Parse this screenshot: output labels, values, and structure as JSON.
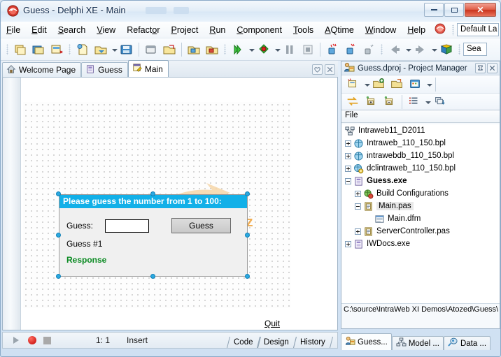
{
  "window": {
    "title": "Guess - Delphi XE - Main",
    "app_icon": "delphi-icon",
    "minimize_label": "Minimize",
    "maximize_label": "Maximize",
    "close_label": "Close"
  },
  "menu": {
    "items": [
      {
        "label": "File",
        "accel": "F"
      },
      {
        "label": "Edit",
        "accel": "E"
      },
      {
        "label": "Search",
        "accel": "S"
      },
      {
        "label": "View",
        "accel": "V"
      },
      {
        "label": "Refactor",
        "accel": "o"
      },
      {
        "label": "Project",
        "accel": "P"
      },
      {
        "label": "Run",
        "accel": "R"
      },
      {
        "label": "Component",
        "accel": "C"
      },
      {
        "label": "Tools",
        "accel": "T"
      },
      {
        "label": "AQtime",
        "accel": "A"
      },
      {
        "label": "Window",
        "accel": "W"
      },
      {
        "label": "Help",
        "accel": "H"
      }
    ],
    "layout_combo_value": "Default La",
    "help_icon": "delphi-help-icon"
  },
  "toolbar": {
    "groups": [
      {
        "icons": [
          "open-project-icon",
          "save-all-icon",
          "open-unit-icon"
        ]
      },
      {
        "icons": [
          "new-file-icon",
          "open-file-icon",
          "save-icon"
        ]
      },
      {
        "icons": [
          "save-as-icon",
          "open-folder-icon"
        ]
      },
      {
        "icons": [
          "add-to-project-icon",
          "remove-from-project-icon"
        ]
      },
      {
        "icons": [
          "run-icon",
          "run-debug-icon",
          "pause-icon",
          "stop-icon"
        ]
      },
      {
        "icons": [
          "trace-into-icon",
          "step-over-icon",
          "run-to-cursor-icon"
        ]
      },
      {
        "icons": [
          "back-nav-icon",
          "forward-nav-icon",
          "help-book-icon"
        ]
      }
    ],
    "search_combo_value": "Sea"
  },
  "editor_tabs": {
    "tabs": [
      {
        "label": "Welcome Page",
        "icon": "home-icon",
        "active": false
      },
      {
        "label": "Guess",
        "icon": "project-icon",
        "active": false
      },
      {
        "label": "Main",
        "icon": "form-icon",
        "active": true
      }
    ],
    "right_buttons": [
      {
        "name": "favorite-button",
        "icon": "heart-icon"
      },
      {
        "name": "close-tab-button",
        "icon": "close-icon"
      }
    ]
  },
  "designer": {
    "form": {
      "header_text": "Please guess the number from 1 to 100:",
      "guess_label": "Guess:",
      "guess_input_value": "",
      "guess_button_label": "Guess",
      "counter_label": "Guess #1",
      "response_label": "Response",
      "response_color": "#0a8a22",
      "header_color": "#12b0e8",
      "selected": true
    },
    "quit_link": "Quit",
    "watermark_text": "sosej.cz"
  },
  "editor_status": {
    "cursor_position": "1:  1",
    "insert_mode": "Insert",
    "view_tabs": [
      {
        "label": "Code"
      },
      {
        "label": "Design"
      },
      {
        "label": "History"
      }
    ]
  },
  "project_manager": {
    "title": "Guess.dproj - Project Manager",
    "title_icon": "project-manager-icon",
    "pin_icon": "pin-icon",
    "close_icon": "close-icon",
    "toolbar_row1": [
      "new-item-icon",
      "new-item-dropdown",
      "add-project-icon",
      "open-project-icon",
      "build-group-icon",
      "build-dropdown"
    ],
    "toolbar_row2": [
      "sync-icon",
      "expand-all-icon",
      "collapse-all-icon",
      "view-mode-icon",
      "view-mode-dropdown",
      "sort-icon"
    ],
    "column_header": "File",
    "tree": [
      {
        "label": "Intraweb11_D2011",
        "indent": 0,
        "expander": "none",
        "icon": "project-group-icon",
        "bold": false,
        "selected": false
      },
      {
        "label": "Intraweb_110_150.bpl",
        "indent": 0,
        "expander": "plus",
        "icon": "package-icon",
        "bold": false,
        "selected": false
      },
      {
        "label": "intrawebdb_110_150.bpl",
        "indent": 0,
        "expander": "plus",
        "icon": "package-icon",
        "bold": false,
        "selected": false
      },
      {
        "label": "dclintraweb_110_150.bpl",
        "indent": 0,
        "expander": "plus",
        "icon": "design-package-icon",
        "bold": false,
        "selected": false
      },
      {
        "label": "Guess.exe",
        "indent": 0,
        "expander": "minus",
        "icon": "exe-icon",
        "bold": true,
        "selected": false
      },
      {
        "label": "Build Configurations",
        "indent": 1,
        "expander": "plus",
        "icon": "build-config-icon",
        "bold": false,
        "selected": false
      },
      {
        "label": "Main.pas",
        "indent": 1,
        "expander": "minus",
        "icon": "unit-icon",
        "bold": false,
        "selected": true
      },
      {
        "label": "Main.dfm",
        "indent": 2,
        "expander": "none",
        "icon": "form-file-icon",
        "bold": false,
        "selected": false
      },
      {
        "label": "ServerController.pas",
        "indent": 1,
        "expander": "plus",
        "icon": "unit-icon",
        "bold": false,
        "selected": false
      },
      {
        "label": "IWDocs.exe",
        "indent": 0,
        "expander": "plus",
        "icon": "exe-icon",
        "bold": false,
        "selected": false
      }
    ],
    "path": "C:\\source\\IntraWeb XI Demos\\Atozed\\Guess\\",
    "bottom_tabs": [
      {
        "label": "Guess...",
        "icon": "project-manager-icon",
        "active": true
      },
      {
        "label": "Model ...",
        "icon": "model-view-icon",
        "active": false
      },
      {
        "label": "Data ...",
        "icon": "data-explorer-icon",
        "active": false
      }
    ]
  }
}
